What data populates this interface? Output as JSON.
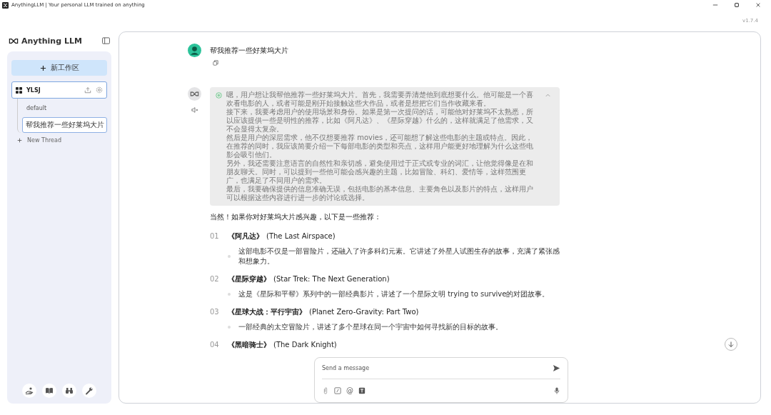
{
  "window": {
    "title": "AnythingLLM | Your personal LLM trained on anything",
    "version": "v1.7.4"
  },
  "sidebar": {
    "brand": "Anything LLM",
    "new_workspace": "新工作区",
    "workspaces": [
      {
        "name": "YLSJ",
        "selected": true,
        "new_thread": "New Thread",
        "threads": [
          {
            "title": "default",
            "selected": false
          },
          {
            "title": "帮我推荐一些好莱坞大片",
            "selected": true
          }
        ]
      }
    ]
  },
  "chat": {
    "messages": [
      {
        "kind": "user",
        "text": "帮我推荐一些好莱坞大片"
      },
      {
        "kind": "assistant",
        "thinking": {
          "expanded": true,
          "paragraphs": [
            "嗯，用户想让我帮他推荐一些好莱坞大片。首先，我需要弄清楚他到底想要什么。他可能是一个喜欢看电影的人，或者可能是刚开始接触这些大作品，或者是想把它们当作收藏来看。",
            "接下来，我要考虑用户的使用场景和身份。如果是第一次提问的话，可能他对好莱坞不太熟悉，所以应该提供一些是明性的推荐，比如《阿凡达》、《星际穿越》什么的，这样就满足了他需求，又不会显得太复杂。",
            "然后是用户的深层需求，他不仅想要推荐 movies，还可能想了解这些电影的主题或特点。因此，在推荐的同时，我应该简要介绍一下每部电影的类型和亮点，这样用户能更好地理解为什么这些电影会吸引他们。",
            "另外，我还需要注意语言的自然性和亲切感，避免使用过于正式或专业的词汇，让他觉得像是在和朋友聊天。同时，可以提到一些他可能会感兴趣的主题，比如冒险、科幻、爱情等，这样范围更广，也满足了不同用户的需求。",
            "最后，我要确保提供的信息准确无误，包括电影的基本信息、主要角色以及影片的特点，这样用户可以根据这些内容进行进一步的讨论或选择。"
          ]
        },
        "intro": "当然！如果你对好莱坞大片感兴趣，以下是一些推荐：",
        "items": [
          {
            "number": "01",
            "title_cn": "《阿凡达》",
            "title_en": "(The Last Airspace)",
            "description": "这部电影不仅是一部冒险片，还融入了许多科幻元素。它讲述了外星人试图生存的故事，充满了紧张感和想象力。"
          },
          {
            "number": "02",
            "title_cn": "《星际穿越》",
            "title_en": "(Star Trek: The Next Generation)",
            "description": "这是《星际和平帮》系列中的一部经典影片，讲述了一个星际文明 trying to survive的对团故事。"
          },
          {
            "number": "03",
            "title_cn": "《星球大战：平行宇宙》",
            "title_en": "(Planet Zero-Gravity: Part Two)",
            "description": "一部经典的太空冒险片，讲述了多个星球在同一个宇宙中如何寻找新的目标的故事。"
          },
          {
            "number": "04",
            "title_cn": "《黑暗骑士》",
            "title_en": "(The Dark Knight)"
          }
        ]
      }
    ]
  },
  "composer": {
    "placeholder": "Send a message",
    "mention": "@"
  }
}
